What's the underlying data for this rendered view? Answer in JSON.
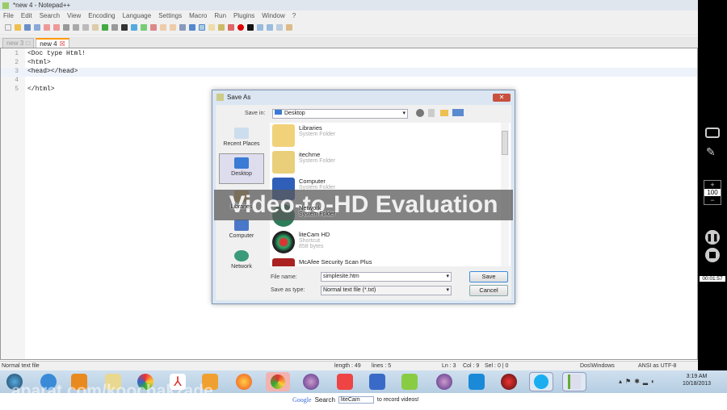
{
  "window": {
    "title": "*new 4 - Notepad++"
  },
  "menu": [
    "File",
    "Edit",
    "Search",
    "View",
    "Encoding",
    "Language",
    "Settings",
    "Macro",
    "Run",
    "Plugins",
    "Window",
    "?"
  ],
  "tabs": [
    {
      "label": "new 3"
    },
    {
      "label": "new 4"
    }
  ],
  "editor": {
    "lines": [
      {
        "no": "1",
        "text": "<Doc type Html!"
      },
      {
        "no": "2",
        "text": "<html>"
      },
      {
        "no": "3",
        "text": "<head></head>"
      },
      {
        "no": "4",
        "text": ""
      },
      {
        "no": "5",
        "text": "</html>"
      }
    ]
  },
  "status": {
    "type": "Normal text file",
    "length": "length : 49",
    "lines": "lines : 5",
    "ln": "Ln : 3",
    "col": "Col : 9",
    "sel": "Sel : 0 | 0",
    "eol": "Dos\\Windows",
    "enc": "ANSI as UTF-8"
  },
  "dialog": {
    "title": "Save As",
    "save_in_label": "Save in:",
    "save_in_value": "Desktop",
    "places": [
      "Recent Places",
      "Desktop",
      "Libraries",
      "Computer",
      "Network"
    ],
    "files": [
      {
        "name": "Libraries",
        "sub": "System Folder"
      },
      {
        "name": "itechme",
        "sub": "System Folder"
      },
      {
        "name": "Computer",
        "sub": "System Folder"
      },
      {
        "name": "Network",
        "sub": "System Folder"
      },
      {
        "name": "liteCam HD",
        "sub": "Shortcut",
        "size": "858 bytes"
      },
      {
        "name": "McAfee Security Scan Plus",
        "sub": ""
      }
    ],
    "file_name_label": "File name:",
    "file_name_value": "simplesite.htm",
    "save_type_label": "Save as type:",
    "save_type_value": "Normal text file (*.txt)",
    "save_button": "Save",
    "cancel_button": "Cancel"
  },
  "watermark": "Video-to-HD Evaluation",
  "recorder": {
    "zoom": "100",
    "plus": "+",
    "minus": "−",
    "timer": "00:01:57"
  },
  "tray": {
    "time": "3:19 AM",
    "date": "10/18/2013"
  },
  "overlay": {
    "site": "aparat.com/koochakzade",
    "google": "Google",
    "search": "Search",
    "search_value": "liteCam",
    "tagline": "to record videos!"
  },
  "colors": {
    "accent": "#f90",
    "dialog_border": "#7a95b5"
  }
}
